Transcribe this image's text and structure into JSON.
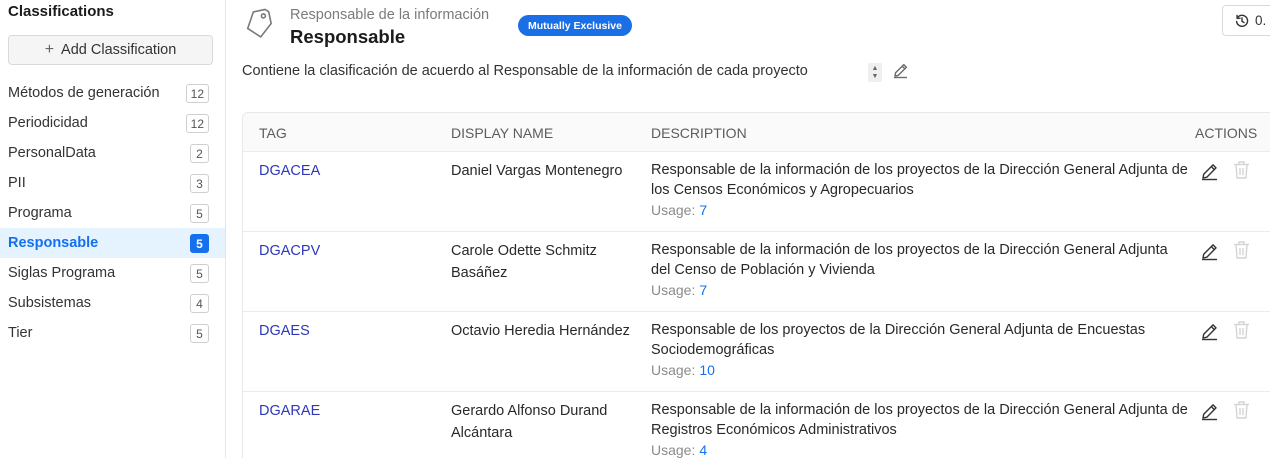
{
  "sidebar": {
    "title": "Classifications",
    "add_button": "Add Classification",
    "items": [
      {
        "label": "Métodos de generación",
        "count": "12"
      },
      {
        "label": "Periodicidad",
        "count": "12"
      },
      {
        "label": "PersonalData",
        "count": "2"
      },
      {
        "label": "PII",
        "count": "3"
      },
      {
        "label": "Programa",
        "count": "5"
      },
      {
        "label": "Responsable",
        "count": "5",
        "active": true
      },
      {
        "label": "Siglas Programa",
        "count": "5"
      },
      {
        "label": "Subsistemas",
        "count": "4"
      },
      {
        "label": "Tier",
        "count": "5"
      }
    ]
  },
  "header": {
    "subtitle": "Responsable de la información",
    "title": "Responsable",
    "badge": "Mutually Exclusive",
    "history_label": "0."
  },
  "description": "Contiene la clasificación de acuerdo al Responsable de la información de cada proyecto",
  "table": {
    "columns": [
      "TAG",
      "DISPLAY NAME",
      "DESCRIPTION",
      "ACTIONS"
    ],
    "usage_label": "Usage:",
    "rows": [
      {
        "tag": "DGACEA",
        "display_name": "Daniel Vargas Montenegro",
        "description": "Responsable de la información de los proyectos de la Dirección General Adjunta de los Censos Económicos y Agropecuarios",
        "usage": "7"
      },
      {
        "tag": "DGACPV",
        "display_name": "Carole Odette Schmitz Basáñez",
        "description": "Responsable de la información de los proyectos de la Dirección General Adjunta del Censo de Población y Vivienda",
        "usage": "7"
      },
      {
        "tag": "DGAES",
        "display_name": "Octavio Heredia Hernández",
        "description": "Responsable de los proyectos de la Dirección General Adjunta de Encuestas Sociodemográficas",
        "usage": "10"
      },
      {
        "tag": "DGARAE",
        "display_name": "Gerardo Alfonso Durand Alcántara",
        "description": "Responsable de la información de los proyectos de la Dirección General Adjunta de Registros Económicos Administrativos",
        "usage": "4"
      }
    ]
  },
  "colors": {
    "accent": "#1570ef",
    "badge": "#1a6fe6",
    "tag_link": "#2e38b8",
    "active_bg": "#e5f3ff"
  }
}
